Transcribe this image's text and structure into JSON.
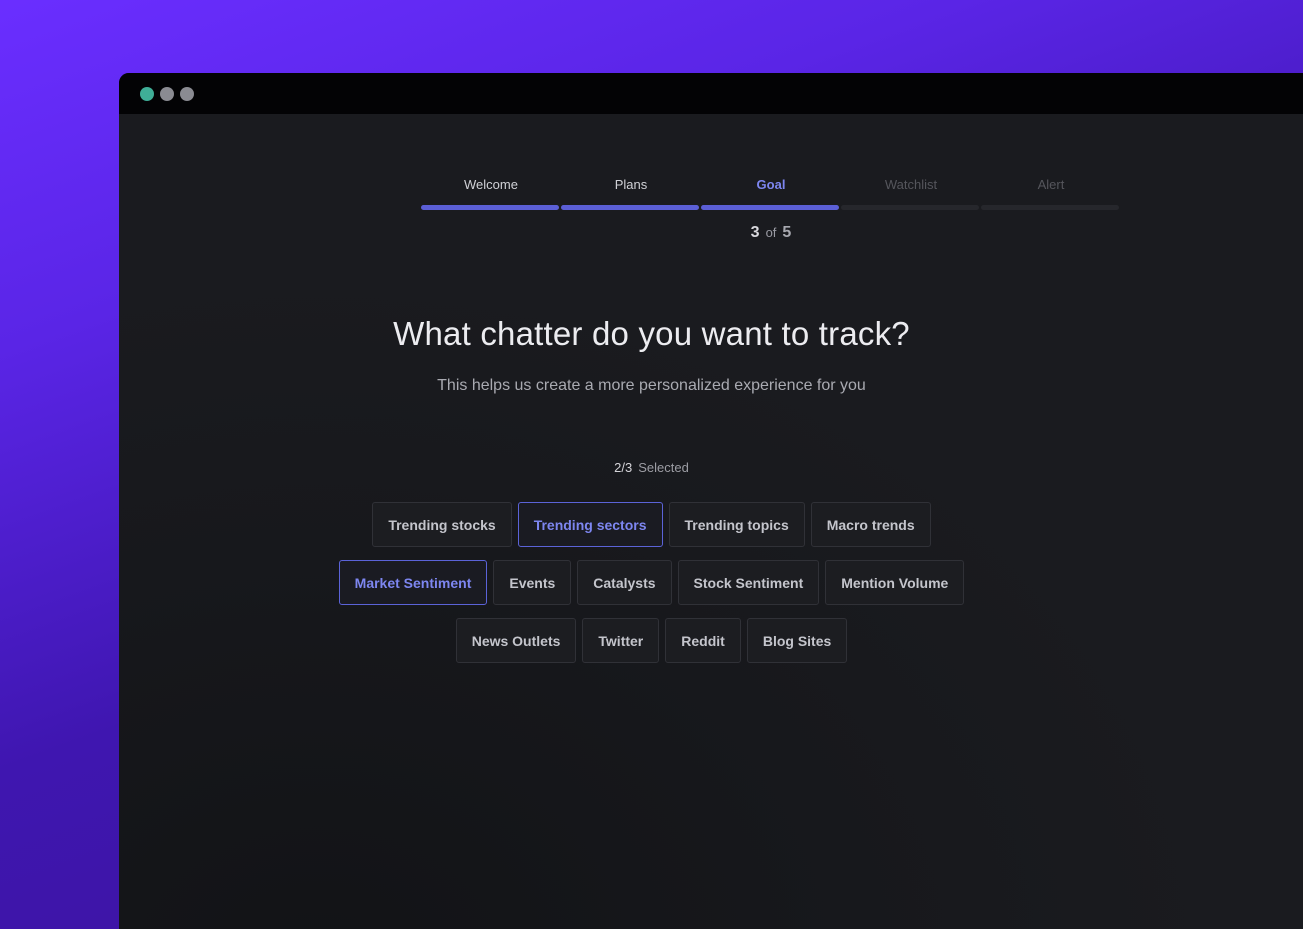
{
  "window": {
    "dots": [
      {
        "name": "window-dot-green",
        "color": "#3fae97"
      },
      {
        "name": "window-dot-gray-1",
        "color": "#8a8b92"
      },
      {
        "name": "window-dot-gray-2",
        "color": "#8a8b92"
      }
    ]
  },
  "stepper": {
    "steps": [
      {
        "label": "Welcome",
        "state": "done"
      },
      {
        "label": "Plans",
        "state": "done"
      },
      {
        "label": "Goal",
        "state": "current"
      },
      {
        "label": "Watchlist",
        "state": "upcoming"
      },
      {
        "label": "Alert",
        "state": "upcoming"
      }
    ],
    "current": "3",
    "of_label": "of",
    "total": "5"
  },
  "colors": {
    "accent": "#5b5fd6",
    "accent_text": "#7d86f0",
    "done_label": "#d0d1d6",
    "upcoming_label": "#55565c",
    "upcoming_bar": "#26272c"
  },
  "heading": "What chatter do you want to track?",
  "subheading": "This helps us create a more personalized experience for you",
  "selection": {
    "count": "2/3",
    "label": "Selected"
  },
  "options": [
    [
      {
        "label": "Trending stocks",
        "selected": false
      },
      {
        "label": "Trending sectors",
        "selected": true
      },
      {
        "label": "Trending topics",
        "selected": false
      },
      {
        "label": "Macro trends",
        "selected": false
      }
    ],
    [
      {
        "label": "Market Sentiment",
        "selected": true
      },
      {
        "label": "Events",
        "selected": false
      },
      {
        "label": "Catalysts",
        "selected": false
      },
      {
        "label": "Stock Sentiment",
        "selected": false
      },
      {
        "label": "Mention Volume",
        "selected": false
      }
    ],
    [
      {
        "label": "News Outlets",
        "selected": false
      },
      {
        "label": "Twitter",
        "selected": false
      },
      {
        "label": "Reddit",
        "selected": false
      },
      {
        "label": "Blog Sites",
        "selected": false
      }
    ]
  ]
}
